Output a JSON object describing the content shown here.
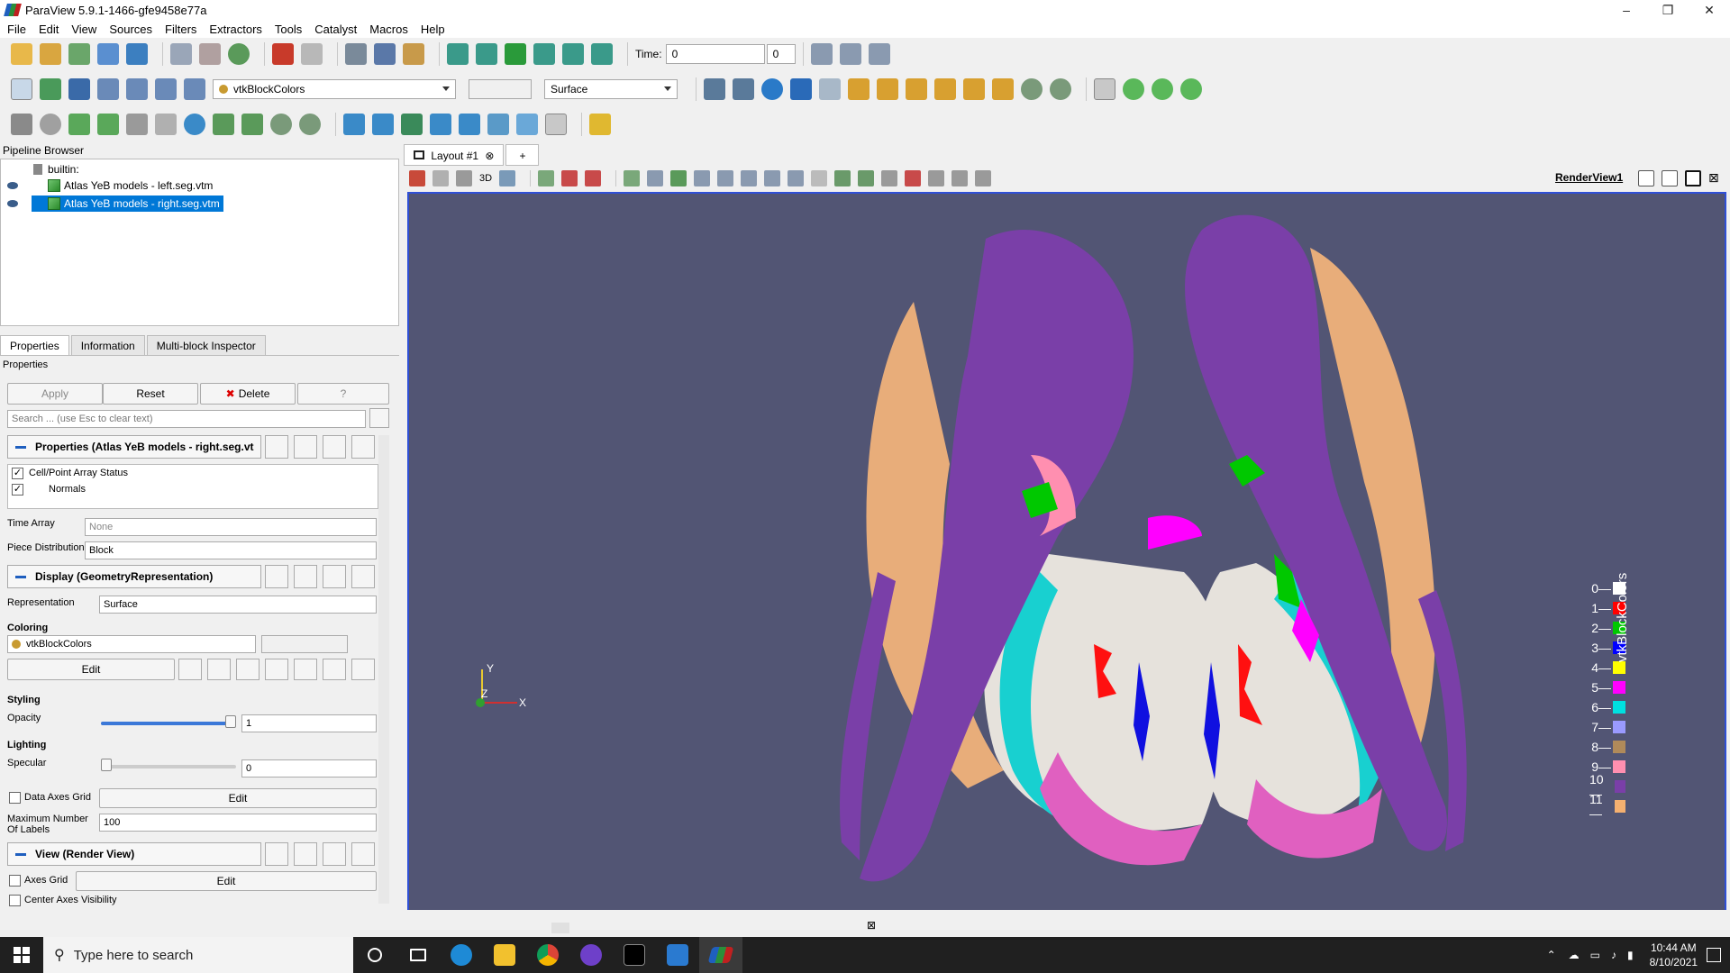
{
  "window": {
    "title": "ParaView 5.9.1-1466-gfe9458e77a",
    "minimize": "–",
    "maximize": "❐",
    "close": "✕"
  },
  "menubar": [
    "File",
    "Edit",
    "View",
    "Sources",
    "Filters",
    "Extractors",
    "Tools",
    "Catalyst",
    "Macros",
    "Help"
  ],
  "toolbar": {
    "time_label": "Time:",
    "time_value": "0",
    "time_index": "0",
    "color_by": "vtkBlockColors",
    "component": "",
    "representation": "Surface"
  },
  "pipeline": {
    "header": "Pipeline Browser",
    "root": "builtin:",
    "items": [
      "Atlas YeB models - left.seg.vtm",
      "Atlas YeB models - right.seg.vtm"
    ],
    "selected_index": 1
  },
  "tabs": [
    "Properties",
    "Information",
    "Multi-block Inspector"
  ],
  "properties": {
    "header": "Properties",
    "apply": "Apply",
    "reset": "Reset",
    "delete": "Delete",
    "help": "?",
    "search_placeholder": "Search ... (use Esc to clear text)",
    "section_props": "Properties (Atlas YeB models - right.seg.vt",
    "array_status_header": "Cell/Point Array Status",
    "array_item": "Normals",
    "time_array_label": "Time Array",
    "time_array_value": "None",
    "piece_dist_label": "Piece Distribution",
    "piece_dist_value": "Block",
    "section_display": "Display (GeometryRepresentation)",
    "representation_label": "Representation",
    "representation_value": "Surface",
    "coloring_label": "Coloring",
    "coloring_value": "vtkBlockColors",
    "edit_label": "Edit",
    "styling_label": "Styling",
    "opacity_label": "Opacity",
    "opacity_value": "1",
    "opacity_level": 1.0,
    "lighting_label": "Lighting",
    "specular_label": "Specular",
    "specular_value": "0",
    "specular_level": 0.0,
    "data_axes_grid_label": "Data Axes Grid",
    "max_labels_label": "Maximum Number Of Labels",
    "max_labels_value": "100",
    "section_view": "View (Render View)",
    "axes_grid_label": "Axes Grid",
    "center_axes_label": "Center Axes Visibility"
  },
  "layout": {
    "tab": "Layout #1",
    "add": "+",
    "view_name": "RenderView1",
    "mode_3d": "3D"
  },
  "orientation_axes": {
    "y": "Y",
    "z": "Z",
    "x": "X"
  },
  "legend": {
    "title": "vtkBlockColors",
    "entries": [
      {
        "label": "0",
        "color": "#ffffff"
      },
      {
        "label": "1",
        "color": "#ff0000"
      },
      {
        "label": "2",
        "color": "#00c800"
      },
      {
        "label": "3",
        "color": "#0000ff"
      },
      {
        "label": "4",
        "color": "#ffff00"
      },
      {
        "label": "5",
        "color": "#ff00ff"
      },
      {
        "label": "6",
        "color": "#00e0e0"
      },
      {
        "label": "7",
        "color": "#9a9aff"
      },
      {
        "label": "8",
        "color": "#b08a5a"
      },
      {
        "label": "9",
        "color": "#ff8fb0"
      },
      {
        "label": "10",
        "color": "#7a3fa8"
      },
      {
        "label": "11",
        "color": "#f5b070"
      }
    ]
  },
  "taskbar": {
    "search_placeholder": "Type here to search",
    "time": "10:44 AM",
    "date": "8/10/2021"
  },
  "colors": {
    "render_bg": "#525574",
    "selection": "#0078d7",
    "view_border": "#2f4fd6"
  }
}
